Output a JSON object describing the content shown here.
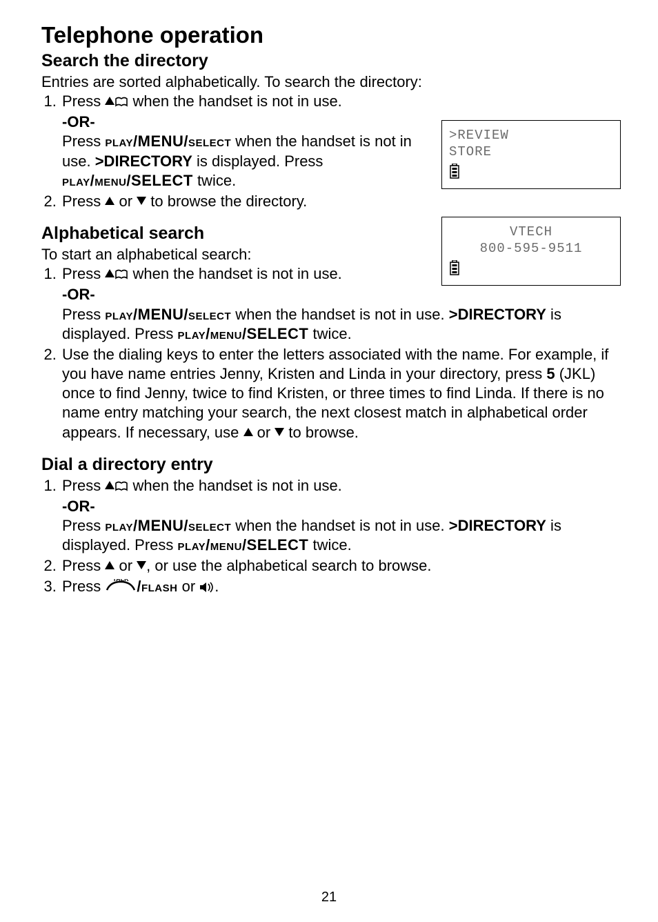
{
  "page": {
    "title": "Telephone operation",
    "number": "21"
  },
  "lcd1": {
    "line1": ">REVIEW",
    "line2": " STORE"
  },
  "lcd2": {
    "line1": "VTECH",
    "line2": "800-595-9511"
  },
  "s1": {
    "heading": "Search the directory",
    "lead": "Entries are sorted alphabetically. To search the directory:",
    "step1a": "Press ",
    "step1b": " when the handset is not in use.",
    "or": "-OR-",
    "step1c_a": "Press ",
    "pms_play": "play",
    "pms_menu": "/MENU/",
    "pms_select": "select",
    "step1c_b": " when the handset is not in use. ",
    "dir": ">DIRECTORY",
    "step1c_c": " is displayed. Press ",
    "pms2_play": "play",
    "pms2_menu": "/menu/",
    "pms2_select": "SELECT",
    "step1c_d": " twice.",
    "step2a": "Press ",
    "step2b": " or ",
    "step2c": " to browse the directory."
  },
  "s2": {
    "heading": "Alphabetical search",
    "lead": "To start an alphabetical search:",
    "step1a": "Press ",
    "step1b": " when the handset is not in use.",
    "or": "-OR-",
    "step1c_a": "Press ",
    "step1c_b": " when the handset is not in use. ",
    "dir": ">DIRECTORY",
    "step1c_c": " is displayed. Press ",
    "step1c_d": " twice.",
    "step2a": "Use the dialing keys to enter the letters associated with the name. For example, if you have name entries Jenny, Kristen and Linda in your directory, press ",
    "five": "5",
    "step2b": " (JKL) once to find Jenny, twice to find Kristen, or three times to find Linda. If there is no name entry matching your search, the next closest match in alphabetical order appears. If necessary, use ",
    "step2c": " or ",
    "step2d": " to browse."
  },
  "s3": {
    "heading": "Dial a directory entry",
    "step1a": "Press ",
    "step1b": " when the handset is not in use.",
    "or": "-OR-",
    "step1c_a": "Press ",
    "step1c_b": " when the handset is not in use. ",
    "dir": ">DIRECTORY",
    "step1c_c": " is displayed. Press ",
    "step1c_d": " twice.",
    "step2a": "Press ",
    "step2b": " or ",
    "step2c": ", or use the alphabetical search to browse.",
    "step3a": "Press ",
    "talk": "TALK",
    "flash": "/flash",
    "step3b": " or ",
    "step3c": "."
  }
}
